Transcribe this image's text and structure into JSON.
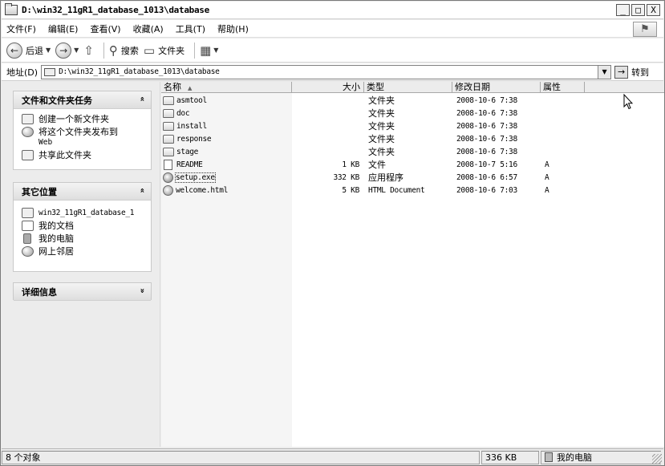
{
  "window": {
    "title": "D:\\win32_11gR1_database_1013\\database",
    "minimize_glyph": "_",
    "maximize_glyph": "□",
    "close_glyph": "X"
  },
  "menubar": {
    "items": [
      "文件(F)",
      "编辑(E)",
      "查看(V)",
      "收藏(A)",
      "工具(T)",
      "帮助(H)"
    ]
  },
  "toolbar": {
    "back_label": "后退",
    "search_label": "搜索",
    "folders_label": "文件夹"
  },
  "address": {
    "label": "地址(D)",
    "value": "D:\\win32_11gR1_database_1013\\database",
    "go_label": "转到"
  },
  "left_pane": {
    "file_tasks": {
      "title": "文件和文件夹任务",
      "items": [
        "创建一个新文件夹",
        "将这个文件夹发布到",
        "共享此文件夹"
      ],
      "publish_sub": "Web"
    },
    "other_places": {
      "title": "其它位置",
      "items": [
        "win32_11gR1_database_1",
        "我的文档",
        "我的电脑",
        "网上邻居"
      ]
    },
    "details": {
      "title": "详细信息"
    },
    "collapse_glyph": "«",
    "expand_glyph": "»"
  },
  "file_list": {
    "columns": {
      "name": "名称",
      "size": "大小",
      "type": "类型",
      "modified": "修改日期",
      "attributes": "属性"
    },
    "rows": [
      {
        "name": "asmtool",
        "size": "",
        "type": "文件夹",
        "modified": "2008-10-6 7:38",
        "attr": "",
        "kind": "folder"
      },
      {
        "name": "doc",
        "size": "",
        "type": "文件夹",
        "modified": "2008-10-6 7:38",
        "attr": "",
        "kind": "folder"
      },
      {
        "name": "install",
        "size": "",
        "type": "文件夹",
        "modified": "2008-10-6 7:38",
        "attr": "",
        "kind": "folder"
      },
      {
        "name": "response",
        "size": "",
        "type": "文件夹",
        "modified": "2008-10-6 7:38",
        "attr": "",
        "kind": "folder"
      },
      {
        "name": "stage",
        "size": "",
        "type": "文件夹",
        "modified": "2008-10-6 7:38",
        "attr": "",
        "kind": "folder"
      },
      {
        "name": "README",
        "size": "1 KB",
        "type": "文件",
        "modified": "2008-10-7 5:16",
        "attr": "A",
        "kind": "file"
      },
      {
        "name": "setup.exe",
        "size": "332 KB",
        "type": "应用程序",
        "modified": "2008-10-6 6:57",
        "attr": "A",
        "kind": "exe"
      },
      {
        "name": "welcome.html",
        "size": "5 KB",
        "type": "HTML Document",
        "modified": "2008-10-6 7:03",
        "attr": "A",
        "kind": "html"
      }
    ]
  },
  "status": {
    "count": "8 个对象",
    "size": "336 KB",
    "location": "我的电脑"
  }
}
